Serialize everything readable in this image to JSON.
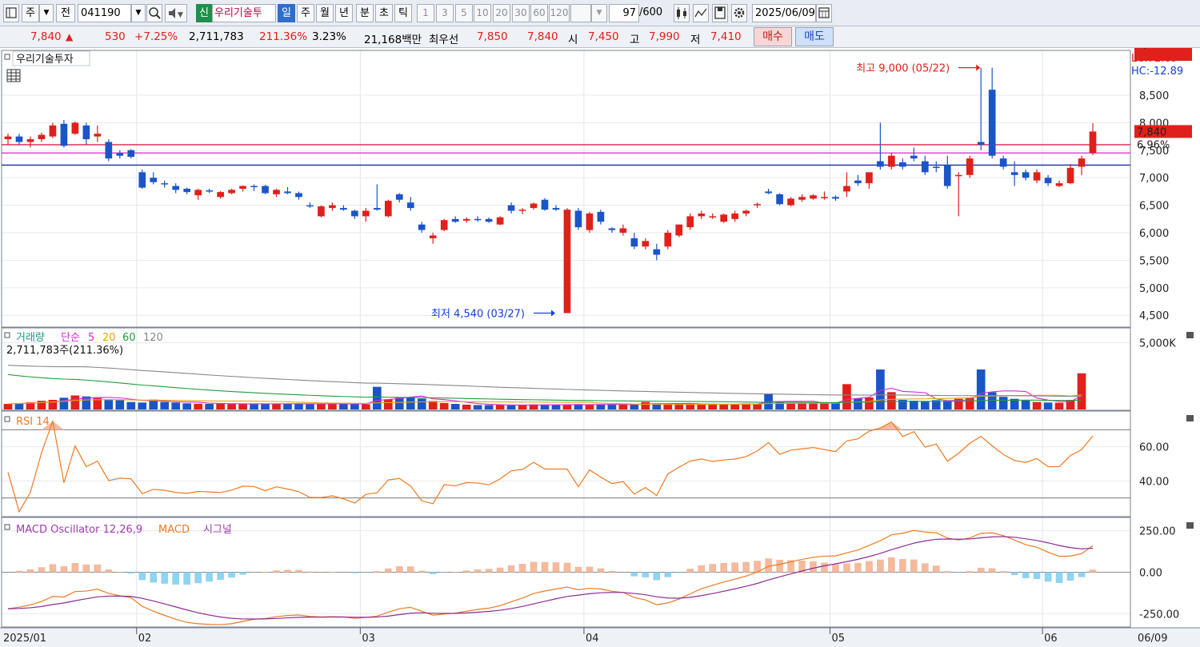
{
  "toolbar": {
    "period_type": "주",
    "prev_label": "전",
    "code": "041190",
    "badge": "신",
    "stock_name": "우리기술투",
    "periods": [
      "일",
      "주",
      "월",
      "년",
      "분",
      "초",
      "틱"
    ],
    "selected_period": "일",
    "intervals": [
      "1",
      "3",
      "5",
      "10",
      "20",
      "30",
      "60",
      "120"
    ],
    "count": "97",
    "count_max": "/600",
    "date": "2025/06/09"
  },
  "quote": {
    "price": "7,840",
    "arrow": "▲",
    "change": "530",
    "change_pct": "+7.25%",
    "volume": "2,711,783",
    "volume_ratio": "211.36%",
    "turnover": "3.23%",
    "amount": "21,168백만",
    "best_label": "최우선",
    "best_ask": "7,850",
    "best_bid": "7,840",
    "open_label": "시",
    "open": "7,450",
    "high_label": "고",
    "high": "7,990",
    "low_label": "저",
    "low": "7,410",
    "buy_label": "매수",
    "sell_label": "매도"
  },
  "colors": {
    "up": "#e0201b",
    "down": "#1a55c8",
    "rsi": "#f07a22",
    "macd": "#f07a22",
    "signal": "#8e2c96",
    "osc_pos": "#f5b99c",
    "osc_neg": "#8fd4f0"
  },
  "chart_data": [
    {
      "type": "candlestick",
      "title": "우리기술투자",
      "ylim": [
        4300,
        9300
      ],
      "y_ticks": [
        "8,500",
        "8,000",
        "7,500",
        "7,000",
        "6,500",
        "6,000",
        "5,500",
        "5,000",
        "4,500"
      ],
      "y_tick_values": [
        8500,
        8000,
        7500,
        7000,
        6500,
        6000,
        5500,
        5000,
        4500
      ],
      "x_labels": [
        "2025/01",
        "02",
        "03",
        "04",
        "05",
        "06",
        "06/09"
      ],
      "x_label_index": [
        0,
        12,
        32,
        52,
        74,
        93,
        96
      ],
      "lc_label": "LC:72.69",
      "hc_label": "HC:-12.89",
      "current_price_label": "7,840",
      "current_pct_label": "6.96%",
      "horizontal_lines": [
        {
          "value": 7600,
          "color": "#e0204a"
        },
        {
          "value": 7450,
          "color": "#e020c8"
        },
        {
          "value": 7230,
          "color": "#1b2ca8"
        }
      ],
      "annotations": [
        {
          "text": "최고 9,000 (05/22)",
          "index": 87,
          "value": 9000,
          "color": "#e0201b"
        },
        {
          "text": "최저 4,540 (03/27)",
          "index": 49,
          "value": 4540,
          "color": "#1540d8"
        }
      ],
      "candles": [
        [
          7700,
          7800,
          7600,
          7750
        ],
        [
          7750,
          7800,
          7600,
          7650
        ],
        [
          7650,
          7750,
          7550,
          7700
        ],
        [
          7700,
          7820,
          7650,
          7780
        ],
        [
          7750,
          8000,
          7720,
          7950
        ],
        [
          7980,
          8050,
          7550,
          7580
        ],
        [
          7800,
          8020,
          7780,
          8000
        ],
        [
          7950,
          8000,
          7600,
          7700
        ],
        [
          7750,
          7950,
          7650,
          7800
        ],
        [
          7650,
          7700,
          7300,
          7350
        ],
        [
          7450,
          7500,
          7350,
          7400
        ],
        [
          7500,
          7520,
          7350,
          7380
        ],
        [
          7100,
          7150,
          6800,
          6820
        ],
        [
          7000,
          7100,
          6880,
          6920
        ],
        [
          6900,
          6950,
          6820,
          6880
        ],
        [
          6850,
          6900,
          6720,
          6780
        ],
        [
          6800,
          6820,
          6700,
          6740
        ],
        [
          6680,
          6800,
          6600,
          6780
        ],
        [
          6770,
          6800,
          6720,
          6760
        ],
        [
          6650,
          6760,
          6620,
          6740
        ],
        [
          6720,
          6800,
          6700,
          6780
        ],
        [
          6800,
          6860,
          6750,
          6850
        ],
        [
          6850,
          6880,
          6760,
          6840
        ],
        [
          6850,
          6870,
          6700,
          6720
        ],
        [
          6700,
          6800,
          6650,
          6780
        ],
        [
          6750,
          6830,
          6700,
          6720
        ],
        [
          6720,
          6750,
          6600,
          6650
        ],
        [
          6500,
          6550,
          6450,
          6480
        ],
        [
          6300,
          6500,
          6280,
          6480
        ],
        [
          6450,
          6550,
          6400,
          6500
        ],
        [
          6450,
          6500,
          6400,
          6420
        ],
        [
          6400,
          6420,
          6250,
          6300
        ],
        [
          6300,
          6450,
          6200,
          6400
        ],
        [
          6450,
          6880,
          6400,
          6420
        ],
        [
          6300,
          6600,
          6280,
          6580
        ],
        [
          6700,
          6720,
          6550,
          6600
        ],
        [
          6550,
          6650,
          6400,
          6450
        ],
        [
          6150,
          6200,
          6000,
          6050
        ],
        [
          5900,
          6000,
          5800,
          5950
        ],
        [
          6050,
          6250,
          6030,
          6230
        ],
        [
          6250,
          6300,
          6180,
          6200
        ],
        [
          6220,
          6280,
          6180,
          6250
        ],
        [
          6250,
          6300,
          6200,
          6240
        ],
        [
          6250,
          6280,
          6180,
          6200
        ],
        [
          6150,
          6300,
          6140,
          6280
        ],
        [
          6500,
          6550,
          6350,
          6400
        ],
        [
          6400,
          6450,
          6340,
          6420
        ],
        [
          6450,
          6550,
          6420,
          6530
        ],
        [
          6600,
          6630,
          6400,
          6420
        ],
        [
          6450,
          6500,
          6400,
          6420
        ],
        [
          4540,
          6450,
          4540,
          6420
        ],
        [
          6400,
          6450,
          6050,
          6100
        ],
        [
          6050,
          6380,
          6000,
          6350
        ],
        [
          6380,
          6420,
          6150,
          6200
        ],
        [
          6080,
          6100,
          6000,
          6050
        ],
        [
          6000,
          6150,
          5950,
          6080
        ],
        [
          5900,
          6000,
          5700,
          5750
        ],
        [
          5750,
          5900,
          5700,
          5850
        ],
        [
          5700,
          5800,
          5500,
          5600
        ],
        [
          5750,
          6050,
          5700,
          6000
        ],
        [
          5950,
          6150,
          5920,
          6150
        ],
        [
          6100,
          6350,
          6050,
          6300
        ],
        [
          6300,
          6400,
          6250,
          6350
        ],
        [
          6300,
          6350,
          6250,
          6300
        ],
        [
          6200,
          6350,
          6180,
          6330
        ],
        [
          6250,
          6400,
          6200,
          6350
        ],
        [
          6350,
          6420,
          6300,
          6400
        ],
        [
          6500,
          6550,
          6450,
          6520
        ],
        [
          6750,
          6800,
          6700,
          6720
        ],
        [
          6700,
          6720,
          6500,
          6520
        ],
        [
          6500,
          6650,
          6480,
          6620
        ],
        [
          6600,
          6700,
          6560,
          6650
        ],
        [
          6620,
          6700,
          6600,
          6680
        ],
        [
          6630,
          6750,
          6600,
          6650
        ],
        [
          6650,
          6680,
          6580,
          6620
        ],
        [
          6750,
          7100,
          6650,
          6850
        ],
        [
          6950,
          7050,
          6850,
          6900
        ],
        [
          6900,
          7100,
          6800,
          7100
        ],
        [
          7300,
          8000,
          7150,
          7200
        ],
        [
          7200,
          7450,
          7150,
          7400
        ],
        [
          7280,
          7350,
          7150,
          7200
        ],
        [
          7400,
          7550,
          7300,
          7350
        ],
        [
          7300,
          7400,
          7050,
          7100
        ],
        [
          7200,
          7300,
          7100,
          7180
        ],
        [
          7230,
          7400,
          6800,
          6850
        ],
        [
          7050,
          7100,
          6300,
          7050
        ],
        [
          7050,
          7400,
          7000,
          7350
        ],
        [
          7650,
          9000,
          7500,
          7600
        ],
        [
          8600,
          9000,
          7350,
          7400
        ],
        [
          7350,
          7400,
          7150,
          7200
        ],
        [
          7100,
          7300,
          6850,
          7050
        ],
        [
          7100,
          7150,
          6950,
          7000
        ],
        [
          6950,
          7150,
          6900,
          7100
        ],
        [
          7000,
          7050,
          6850,
          6900
        ],
        [
          6850,
          6950,
          6830,
          6900
        ],
        [
          6900,
          7250,
          6880,
          7180
        ],
        [
          7200,
          7400,
          7050,
          7350
        ],
        [
          7450,
          7990,
          7410,
          7840
        ]
      ]
    },
    {
      "type": "bar",
      "title": "거래량",
      "legend": [
        "단순",
        "5",
        "20",
        "60",
        "120"
      ],
      "value_label": "2,711,783주(211.36%)",
      "y_ticks": [
        "5,000K"
      ],
      "current_label": "2,712K",
      "current_pct_label": "211.36%",
      "ylim": [
        0,
        6000
      ],
      "volumes_k": [
        420,
        470,
        540,
        650,
        720,
        880,
        1050,
        980,
        860,
        760,
        700,
        560,
        520,
        740,
        560,
        520,
        460,
        430,
        420,
        430,
        420,
        420,
        440,
        420,
        440,
        430,
        420,
        400,
        420,
        430,
        450,
        420,
        400,
        1700,
        760,
        880,
        880,
        820,
        640,
        480,
        420,
        360,
        330,
        330,
        340,
        320,
        350,
        380,
        360,
        330,
        360,
        400,
        380,
        380,
        370,
        360,
        380,
        560,
        460,
        420,
        420,
        400,
        380,
        390,
        380,
        410,
        450,
        420,
        1200,
        520,
        480,
        450,
        460,
        460,
        470,
        1900,
        850,
        900,
        3000,
        1300,
        720,
        660,
        600,
        700,
        640,
        800,
        900,
        3000,
        1300,
        950,
        800,
        680,
        560,
        520,
        510,
        720,
        2712
      ]
    },
    {
      "type": "line",
      "title": "RSI 14",
      "ylim": [
        20,
        80
      ],
      "y_ticks": [
        "60.00",
        "40.00"
      ],
      "y_tick_values": [
        60,
        40
      ]
    },
    {
      "type": "bar",
      "title": "MACD Oscillator 12,26,9",
      "legend": [
        "MACD",
        "시그널"
      ],
      "ylim": [
        -320,
        320
      ],
      "y_ticks": [
        "250.00",
        "0.00",
        "-250.00"
      ],
      "y_tick_values": [
        250,
        0,
        -250
      ]
    }
  ]
}
